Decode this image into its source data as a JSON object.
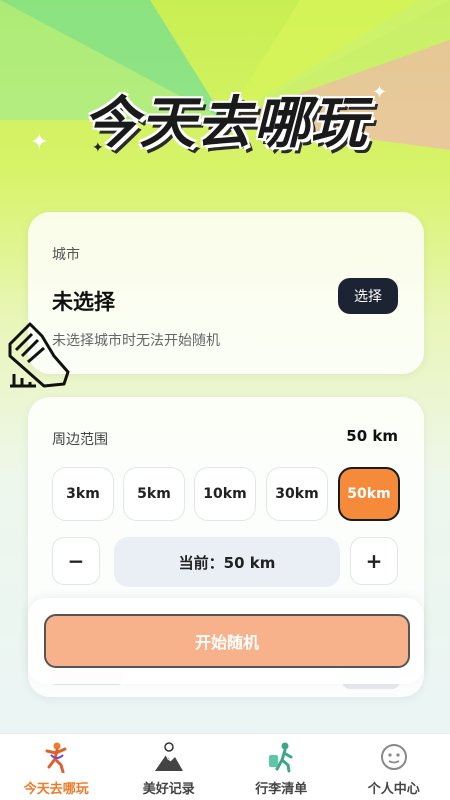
{
  "header": {
    "title": "今天去哪玩"
  },
  "city": {
    "label": "城市",
    "value": "未选择",
    "select_label": "选择",
    "hint": "未选择城市时无法开始随机"
  },
  "range": {
    "label": "周边范围",
    "value": "50 km",
    "options": [
      {
        "label": "3km",
        "selected": false
      },
      {
        "label": "5km",
        "selected": false
      },
      {
        "label": "10km",
        "selected": false
      },
      {
        "label": "30km",
        "selected": false
      },
      {
        "label": "50km",
        "selected": true
      }
    ],
    "decrement": "−",
    "increment": "+",
    "current": "当前：50 km"
  },
  "start_button": "开始随机",
  "tabs": [
    {
      "label": "今天去哪玩",
      "icon": "dancer-icon",
      "active": true
    },
    {
      "label": "美好记录",
      "icon": "mountain-icon",
      "active": false
    },
    {
      "label": "行李清单",
      "icon": "traveler-icon",
      "active": false
    },
    {
      "label": "个人中心",
      "icon": "smiley-icon",
      "active": false
    }
  ],
  "colors": {
    "accent": "#f48a3a",
    "start": "#f7b28c",
    "dark_button": "#1c2433"
  }
}
